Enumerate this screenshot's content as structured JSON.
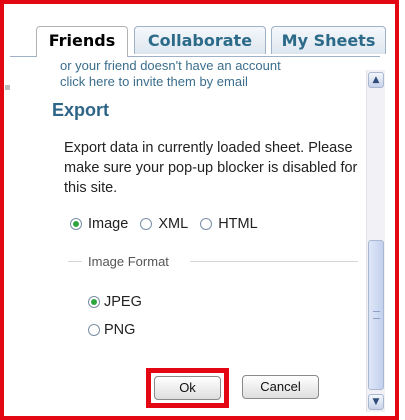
{
  "tabs": [
    {
      "label": "Friends",
      "active": true
    },
    {
      "label": "Collaborate",
      "active": false
    },
    {
      "label": "My Sheets",
      "active": false
    }
  ],
  "invite": {
    "cutoff_text": "or your friend doesn't have an account",
    "link_text": "click here to invite them by email"
  },
  "export": {
    "title": "Export",
    "description": "Export data in currently loaded sheet. Please make sure your pop-up blocker is disabled for this site.",
    "format_options": [
      {
        "label": "Image",
        "selected": true
      },
      {
        "label": "XML",
        "selected": false
      },
      {
        "label": "HTML",
        "selected": false
      }
    ],
    "image_format_label": "Image Format",
    "image_formats": [
      {
        "label": "JPEG",
        "selected": true
      },
      {
        "label": "PNG",
        "selected": false
      }
    ],
    "ok_label": "Ok",
    "cancel_label": "Cancel"
  },
  "colors": {
    "highlight": "#e30613",
    "accent": "#2e6587",
    "radio_selected": "#2fa53e"
  }
}
